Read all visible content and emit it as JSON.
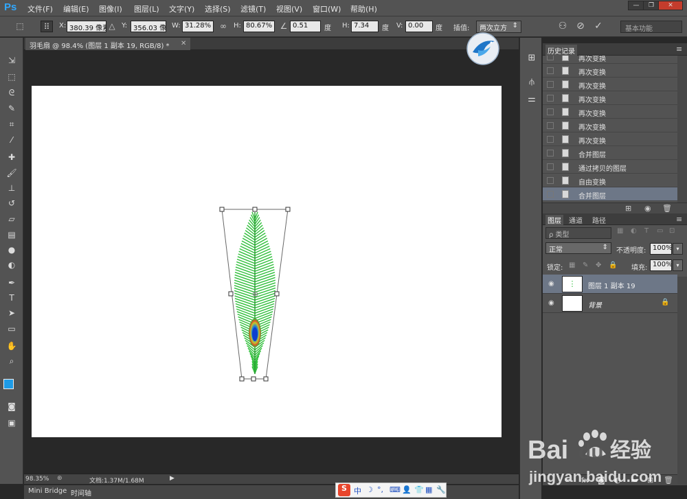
{
  "menubar": {
    "logo": "Ps",
    "items": [
      "文件(F)",
      "编辑(E)",
      "图像(I)",
      "图层(L)",
      "文字(Y)",
      "选择(S)",
      "滤镜(T)",
      "视图(V)",
      "窗口(W)",
      "帮助(H)"
    ],
    "window_buttons": [
      "—",
      "❐",
      "✕"
    ]
  },
  "options": {
    "x_label": "X:",
    "x_value": "380.39 像素",
    "y_label": "Y:",
    "y_value": "356.03 像素",
    "w_label": "W:",
    "w_value": "31.28%",
    "h_label": "H:",
    "h_value": "80.67%",
    "angle_value": "0.51",
    "angle_unit": "度",
    "hskew_label": "H:",
    "hskew_value": "7.34",
    "hskew_unit": "度",
    "vskew_label": "V:",
    "vskew_value": "0.00",
    "vskew_unit": "度",
    "interp_label": "插值:",
    "interp_value": "两次立方",
    "workspace": "基本功能"
  },
  "document": {
    "tab_title": "羽毛扇 @ 98.4% (图层 1 副本 19, RGB/8) *",
    "zoom": "98.35%",
    "doc_info": "文档:1.37M/1.68M"
  },
  "bottom_tabs": [
    "Mini Bridge",
    "时间轴"
  ],
  "history": {
    "tab": "历史记录",
    "items": [
      {
        "label": "再次变换",
        "selected": false
      },
      {
        "label": "再次变换",
        "selected": false
      },
      {
        "label": "再次变换",
        "selected": false
      },
      {
        "label": "再次变换",
        "selected": false
      },
      {
        "label": "再次变换",
        "selected": false
      },
      {
        "label": "再次变换",
        "selected": false
      },
      {
        "label": "再次变换",
        "selected": false
      },
      {
        "label": "合并图层",
        "selected": false
      },
      {
        "label": "通过拷贝的图层",
        "selected": false
      },
      {
        "label": "自由变换",
        "selected": false
      },
      {
        "label": "合并图层",
        "selected": true
      }
    ]
  },
  "layers_panel": {
    "tabs": [
      "图层",
      "通道",
      "路径"
    ],
    "kind_filter": "ρ 类型",
    "blend_mode": "正常",
    "opacity_label": "不透明度:",
    "opacity_value": "100%",
    "lock_label": "锁定:",
    "fill_label": "填充:",
    "fill_value": "100%",
    "layers": [
      {
        "name": "图层 1 副本 19",
        "selected": true
      },
      {
        "name": "背景",
        "selected": false
      }
    ]
  },
  "ime": [
    "S",
    "中",
    "☽",
    "°,",
    "⌨",
    "👤",
    "👕",
    "▦",
    "🔧"
  ],
  "watermark": {
    "logo_text": "Bai",
    "logo_text2": "du",
    "cn": "经验",
    "url": "jingyan.baidu.com"
  },
  "colors": {
    "foreground": "#1e9be6",
    "background": "#c0221f",
    "feather_green": "#2fbf3a",
    "selected_row": "#6d7787"
  }
}
